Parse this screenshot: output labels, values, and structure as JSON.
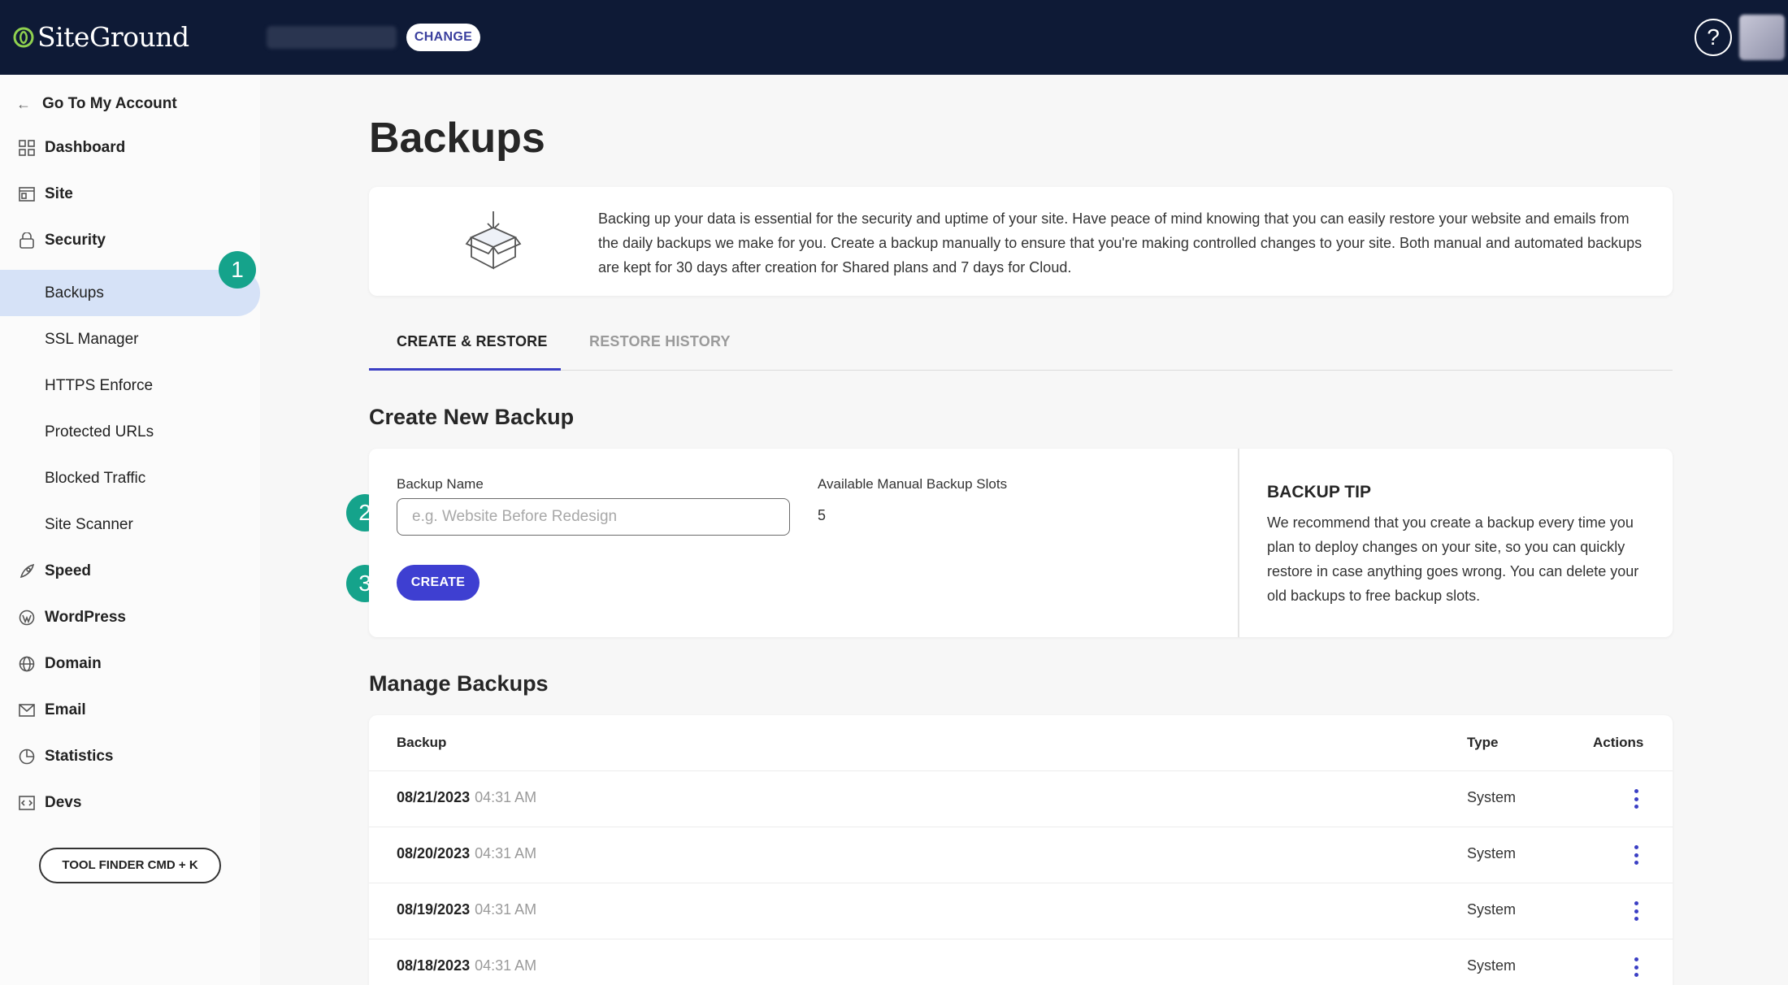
{
  "header": {
    "logo_text": "SiteGround",
    "change_label": "CHANGE",
    "help_label": "?"
  },
  "sidebar": {
    "go_account": "Go To My Account",
    "items": [
      {
        "label": "Dashboard",
        "icon": "grid-icon"
      },
      {
        "label": "Site",
        "icon": "site-icon"
      },
      {
        "label": "Security",
        "icon": "lock-icon"
      },
      {
        "label": "Backups"
      },
      {
        "label": "SSL Manager"
      },
      {
        "label": "HTTPS Enforce"
      },
      {
        "label": "Protected URLs"
      },
      {
        "label": "Blocked Traffic"
      },
      {
        "label": "Site Scanner"
      },
      {
        "label": "Speed",
        "icon": "rocket-icon"
      },
      {
        "label": "WordPress",
        "icon": "wordpress-icon"
      },
      {
        "label": "Domain",
        "icon": "globe-icon"
      },
      {
        "label": "Email",
        "icon": "envelope-icon"
      },
      {
        "label": "Statistics",
        "icon": "pie-chart-icon"
      },
      {
        "label": "Devs",
        "icon": "code-icon"
      }
    ],
    "tool_finder": "TOOL FINDER CMD + K"
  },
  "steps": [
    "1",
    "2",
    "3"
  ],
  "main": {
    "title": "Backups",
    "info_text": "Backing up your data is essential for the security and uptime of your site. Have peace of mind knowing that you can easily restore your website and emails from the daily backups we make for you. Create a backup manually to ensure that you're making controlled changes to your site. Both manual and automated backups are kept for 30 days after creation for Shared plans and 7 days for Cloud.",
    "tabs": [
      "CREATE & RESTORE",
      "RESTORE HISTORY"
    ],
    "create": {
      "section_title": "Create New Backup",
      "name_label": "Backup Name",
      "name_placeholder": "e.g. Website Before Redesign",
      "slots_label": "Available Manual Backup Slots",
      "slots_value": "5",
      "create_button": "CREATE",
      "tip_title": "BACKUP TIP",
      "tip_text": "We recommend that you create a backup every time you plan to deploy changes on your site, so you can quickly restore in case anything goes wrong. You can delete your old backups to free backup slots."
    },
    "manage": {
      "section_title": "Manage Backups",
      "columns": [
        "Backup",
        "Type",
        "Actions"
      ],
      "rows": [
        {
          "date": "08/21/2023",
          "time": "04:31 AM",
          "type": "System"
        },
        {
          "date": "08/20/2023",
          "time": "04:31 AM",
          "type": "System"
        },
        {
          "date": "08/19/2023",
          "time": "04:31 AM",
          "type": "System"
        },
        {
          "date": "08/18/2023",
          "time": "04:31 AM",
          "type": "System"
        }
      ]
    }
  },
  "colors": {
    "topbar": "#0e1a36",
    "accent": "#3e3fd1",
    "step_badge": "#15a38b",
    "active_nav": "#d6e2f7"
  }
}
